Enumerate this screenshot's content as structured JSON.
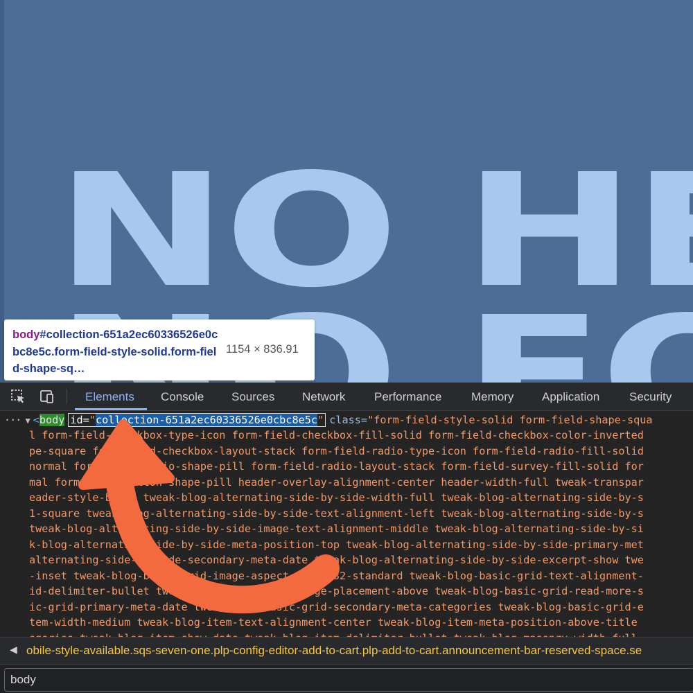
{
  "page": {
    "hero_line1": "NO HEA",
    "hero_line2": "NO FOO"
  },
  "tooltip": {
    "selector_tag": "body",
    "selector_rest": "#collection-651a2ec60336526e0cbc8e5c.form-field-style-solid.form-field-shape-sq…",
    "dimensions": "1154 × 836.91"
  },
  "devtools": {
    "tabs": [
      "Elements",
      "Console",
      "Sources",
      "Network",
      "Performance",
      "Memory",
      "Application",
      "Security"
    ],
    "active_tab": "Elements",
    "dom": {
      "ellipsis": "···",
      "expand_arrow": "▼",
      "tag_open": "<",
      "tag": "body",
      "id_attr_name": "id=",
      "id_quote": "\"",
      "id_value": "collection-651a2ec60336526e0cbc8e5c",
      "class_attr_name": "class=",
      "class_value_start": "\"form-field-style-solid form-field-shape-squa",
      "lines": [
        "l form-field-checkbox-type-icon form-field-checkbox-fill-solid form-field-checkbox-color-inverted",
        "pe-square form-field-checkbox-layout-stack form-field-radio-type-icon form-field-radio-fill-solid",
        "normal form-field-radio-shape-pill form-field-radio-layout-stack form-field-survey-fill-solid for",
        "mal form-field-button-shape-pill header-overlay-alignment-center header-width-full tweak-transpar",
        "eader-style-basic tweak-blog-alternating-side-by-side-width-full tweak-blog-alternating-side-by-s",
        "1-square tweak-blog-alternating-side-by-side-text-alignment-left tweak-blog-alternating-side-by-s",
        "tweak-blog-alternating-side-by-side-image-text-alignment-middle tweak-blog-alternating-side-by-si",
        "k-blog-alternating-side-by-side-meta-position-top tweak-blog-alternating-side-by-side-primary-met",
        "alternating-side-by-side-secondary-meta-date tweak-blog-alternating-side-by-side-excerpt-show twe",
        "-inset tweak-blog-basic-grid-image-aspect-ratio-32-standard tweak-blog-basic-grid-text-alignment-",
        "id-delimiter-bullet tweak-blog-basic-grid-image-placement-above tweak-blog-basic-grid-read-more-s",
        "ic-grid-primary-meta-date tweak-blog-basic-grid-secondary-meta-categories tweak-blog-basic-grid-e",
        "tem-width-medium tweak-blog-item-text-alignment-center tweak-blog-item-meta-position-above-title",
        "egories tweak-blog-item-show-date tweak-blog-item-delimiter-bullet tweak-blog-masonry-width-full"
      ]
    },
    "breadcrumb": "obile-style-available.sqs-seven-one.plp-config-editor-add-to-cart.plp-add-to-cart.announcement-bar-reserved-space.se",
    "breadcrumb_left": "◀",
    "filter_value": "body"
  },
  "colors": {
    "page_bg": "#4c6e96",
    "hero_text": "#a9c8ee",
    "devtools_bg": "#242424",
    "accent": "#8ab4f8",
    "arrow": "#f26a3d"
  }
}
